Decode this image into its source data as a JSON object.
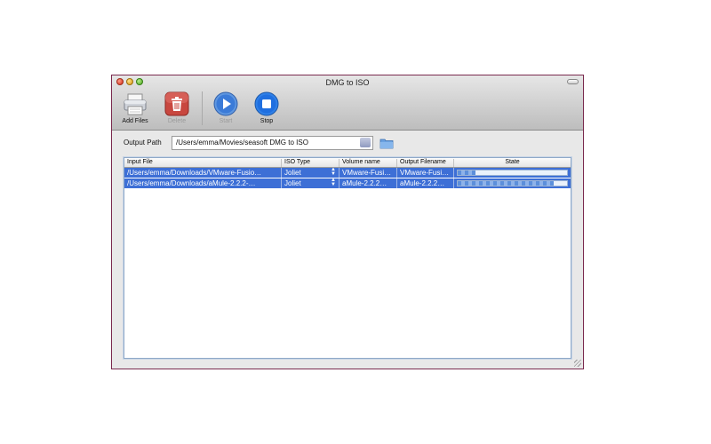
{
  "window": {
    "title": "DMG to ISO"
  },
  "toolbar": {
    "add_files": {
      "label": "Add Files",
      "icon": "printer-icon"
    },
    "delete": {
      "label": "Delete",
      "icon": "trash-icon",
      "enabled": false
    },
    "start": {
      "label": "Start",
      "icon": "play-icon",
      "enabled": false
    },
    "stop": {
      "label": "Stop",
      "icon": "stop-icon"
    }
  },
  "output": {
    "label": "Output Path",
    "value": "/Users/emma/Movies/seasoft DMG to ISO"
  },
  "table": {
    "columns": [
      "Input File",
      "ISO Type",
      "Volume name",
      "Output Filename",
      "State"
    ],
    "rows": [
      {
        "input_file": "/Users/emma/Downloads/VMware-Fusio…",
        "iso_type": "Joliet",
        "volume_name": "VMware-Fusi…",
        "output_filename": "VMware-Fusi…",
        "progress": 0.16
      },
      {
        "input_file": "/Users/emma/Downloads/aMule-2.2.2-…",
        "iso_type": "Joliet",
        "volume_name": "aMule-2.2.2…",
        "output_filename": "aMule-2.2.2…",
        "progress": 0.88
      }
    ]
  },
  "colors": {
    "selection": "#3d6fd6",
    "window_border": "#7a2a4e"
  }
}
